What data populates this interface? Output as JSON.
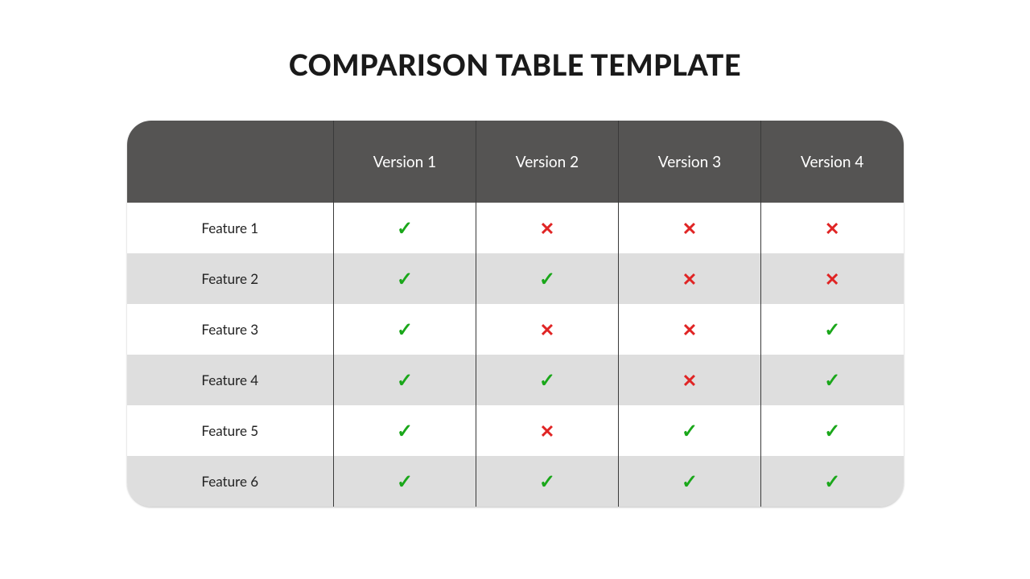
{
  "title": "COMPARISON TABLE TEMPLATE",
  "columns": [
    "Version 1",
    "Version 2",
    "Version 3",
    "Version 4"
  ],
  "features": [
    "Feature 1",
    "Feature 2",
    "Feature 3",
    "Feature 4",
    "Feature 5",
    "Feature 6"
  ],
  "marks": {
    "check": "✓",
    "cross": "✕"
  },
  "chart_data": {
    "type": "table",
    "title": "COMPARISON TABLE TEMPLATE",
    "columns": [
      "Version 1",
      "Version 2",
      "Version 3",
      "Version 4"
    ],
    "rows": [
      {
        "feature": "Feature 1",
        "values": [
          true,
          false,
          false,
          false
        ]
      },
      {
        "feature": "Feature 2",
        "values": [
          true,
          true,
          false,
          false
        ]
      },
      {
        "feature": "Feature 3",
        "values": [
          true,
          false,
          false,
          true
        ]
      },
      {
        "feature": "Feature 4",
        "values": [
          true,
          true,
          false,
          true
        ]
      },
      {
        "feature": "Feature 5",
        "values": [
          true,
          false,
          true,
          true
        ]
      },
      {
        "feature": "Feature 6",
        "values": [
          true,
          true,
          true,
          true
        ]
      }
    ]
  }
}
